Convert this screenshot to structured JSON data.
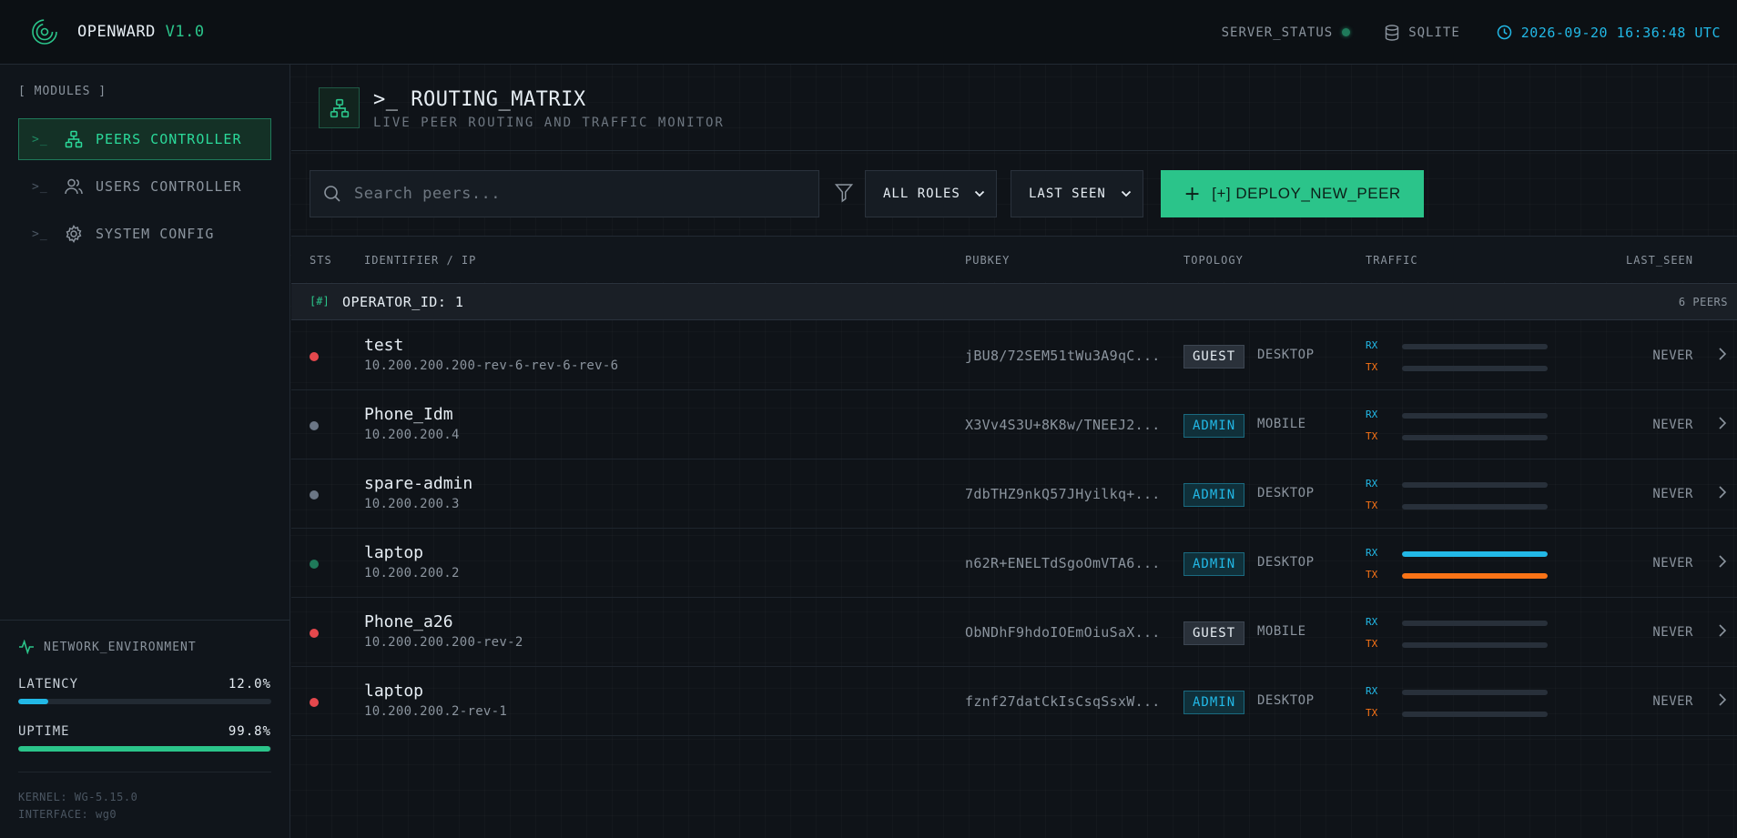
{
  "app": {
    "name": "OPENWARD",
    "version": "V1.0",
    "server_status_label": "SERVER_STATUS",
    "db_label": "SQLITE",
    "datetime": "2026-09-20 16:36:48 UTC"
  },
  "sidebar": {
    "modules_label": "[ MODULES ]",
    "prompt": ">_",
    "items": [
      {
        "label": "PEERS CONTROLLER",
        "icon": "network-icon",
        "active": true
      },
      {
        "label": "USERS CONTROLLER",
        "icon": "users-icon",
        "active": false
      },
      {
        "label": "SYSTEM CONFIG",
        "icon": "gear-icon",
        "active": false
      }
    ],
    "network_env_label": "NETWORK_ENVIRONMENT",
    "metrics": [
      {
        "label": "LATENCY",
        "value": "12.0%",
        "fraction": 0.12,
        "color": "#22b8e6"
      },
      {
        "label": "UPTIME",
        "value": "99.8%",
        "fraction": 0.998,
        "color": "#2bc48a"
      }
    ],
    "kernel": "KERNEL: WG-5.15.0",
    "interface": "INTERFACE: wg0"
  },
  "header": {
    "title": ">_ ROUTING_MATRIX",
    "subtitle": "LIVE PEER ROUTING AND TRAFFIC MONITOR"
  },
  "toolbar": {
    "search_placeholder": "Search peers...",
    "role_filter": "ALL ROLES",
    "sort": "LAST SEEN",
    "deploy_label": "[+] DEPLOY_NEW_PEER"
  },
  "table": {
    "columns": {
      "sts": "STS",
      "identifier": "IDENTIFIER / IP",
      "pubkey": "PUBKEY",
      "topology": "TOPOLOGY",
      "traffic": "TRAFFIC",
      "last_seen": "LAST_SEEN"
    },
    "group": {
      "tag": "[#]",
      "label": "OPERATOR_ID: 1",
      "count": "6 PEERS"
    },
    "rx_label": "RX",
    "tx_label": "TX",
    "rows": [
      {
        "status": "offline",
        "status_color": "#e5484d",
        "name": "test",
        "ip": "10.200.200.200-rev-6-rev-6-rev-6",
        "pubkey": "jBU8/72SEM51tWu3A9qC...",
        "role": "GUEST",
        "device": "DESKTOP",
        "rx": 0,
        "tx": 0,
        "last_seen": "NEVER"
      },
      {
        "status": "idle",
        "status_color": "#6b7685",
        "name": "Phone_Idm",
        "ip": "10.200.200.4",
        "pubkey": "X3Vv4S3U+8K8w/TNEEJ2...",
        "role": "ADMIN",
        "device": "MOBILE",
        "rx": 0,
        "tx": 0,
        "last_seen": "NEVER"
      },
      {
        "status": "idle",
        "status_color": "#6b7685",
        "name": "spare-admin",
        "ip": "10.200.200.3",
        "pubkey": "7dbTHZ9nkQ57JHyilkq+...",
        "role": "ADMIN",
        "device": "DESKTOP",
        "rx": 0,
        "tx": 0,
        "last_seen": "NEVER"
      },
      {
        "status": "online",
        "status_color": "#1f7a5a",
        "name": "laptop",
        "ip": "10.200.200.2",
        "pubkey": "n62R+ENELTdSgoOmVTA6...",
        "role": "ADMIN",
        "device": "DESKTOP",
        "rx": 1,
        "tx": 1,
        "last_seen": "NEVER"
      },
      {
        "status": "offline",
        "status_color": "#e5484d",
        "name": "Phone_a26",
        "ip": "10.200.200.200-rev-2",
        "pubkey": "ObNDhF9hdoIOEmOiuSaX...",
        "role": "GUEST",
        "device": "MOBILE",
        "rx": 0,
        "tx": 0,
        "last_seen": "NEVER"
      },
      {
        "status": "offline",
        "status_color": "#e5484d",
        "name": "laptop",
        "ip": "10.200.200.2-rev-1",
        "pubkey": "fznf27datCkIsCsqSsxW...",
        "role": "ADMIN",
        "device": "DESKTOP",
        "rx": 0,
        "tx": 0,
        "last_seen": "NEVER"
      }
    ]
  },
  "colors": {
    "accent": "#2bc48a",
    "info": "#22b8e6",
    "rx": "#22b8e6",
    "tx": "#f97316"
  }
}
